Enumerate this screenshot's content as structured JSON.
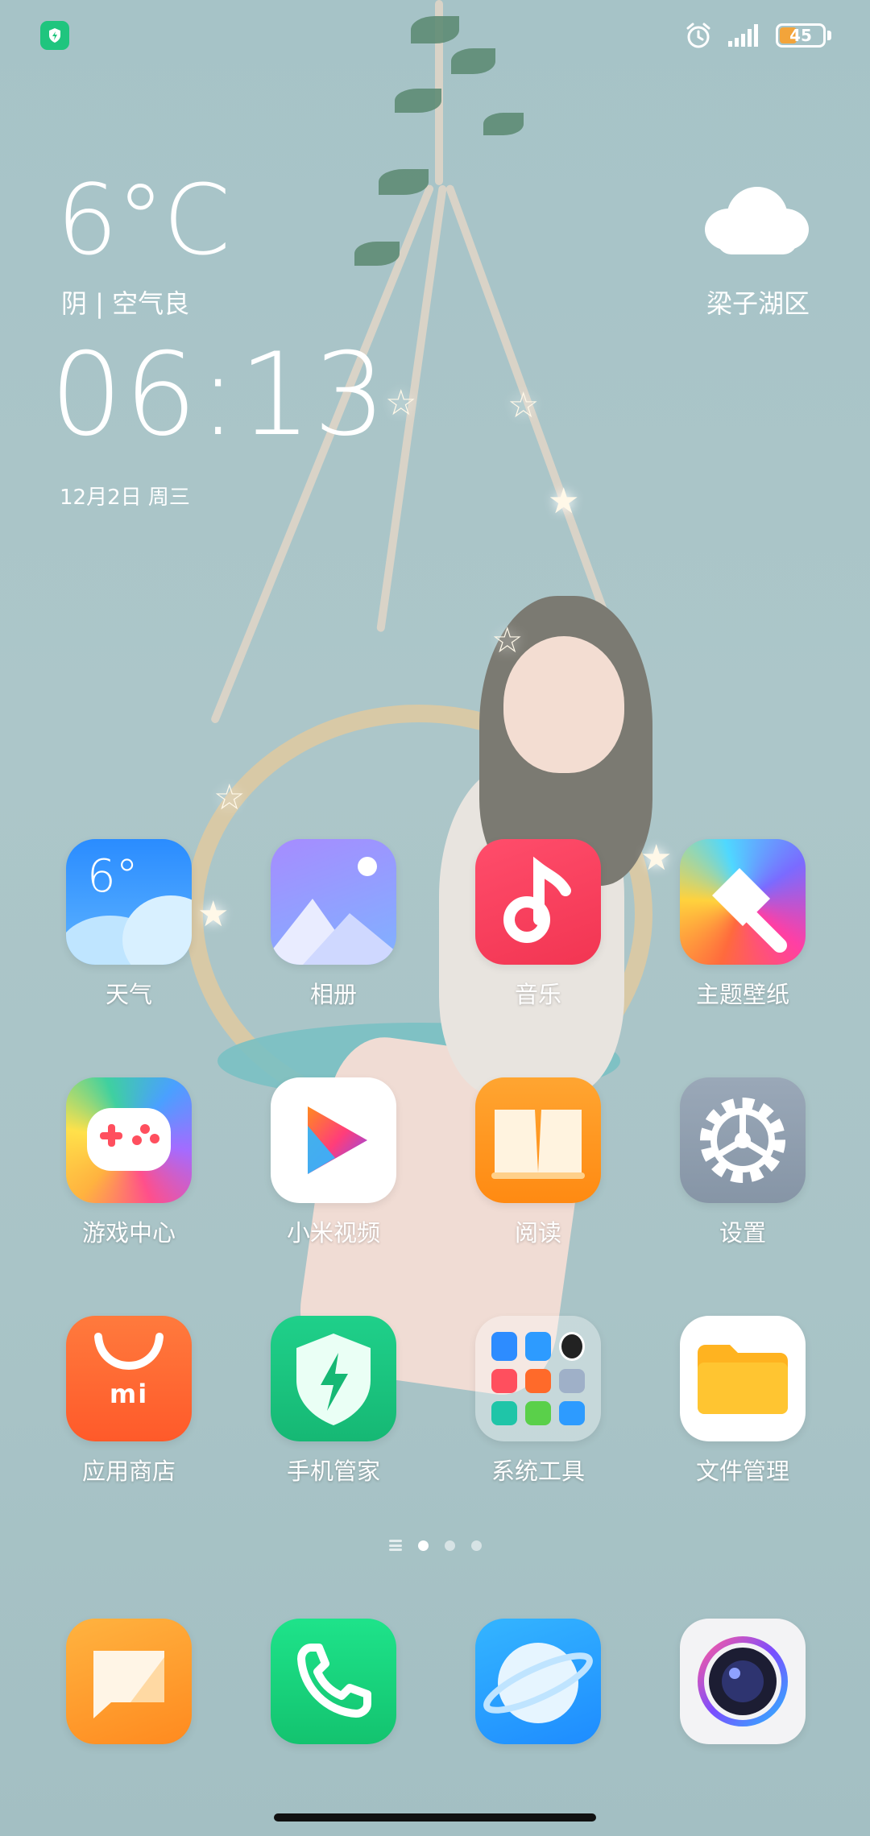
{
  "status_bar": {
    "battery_level": 45,
    "battery_text": "45",
    "icons": [
      "security-shield-icon",
      "alarm-icon",
      "signal-icon",
      "battery-icon"
    ]
  },
  "weather_widget": {
    "temperature": "6°C",
    "condition": "阴 | 空气良",
    "location": "梁子湖区",
    "icon": "cloud-icon"
  },
  "clock_widget": {
    "time": "06:13",
    "date": "12月2日 周三"
  },
  "apps": {
    "weather": {
      "label": "天气",
      "badge": "6°"
    },
    "gallery": {
      "label": "相册"
    },
    "music": {
      "label": "音乐"
    },
    "themes": {
      "label": "主题壁纸"
    },
    "game_center": {
      "label": "游戏中心"
    },
    "mi_video": {
      "label": "小米视频"
    },
    "reader": {
      "label": "阅读"
    },
    "settings": {
      "label": "设置"
    },
    "app_store": {
      "label": "应用商店",
      "logo": "mi"
    },
    "security": {
      "label": "手机管家"
    },
    "system_tools": {
      "label": "系统工具"
    },
    "file_manager": {
      "label": "文件管理"
    }
  },
  "dock": [
    "messages-app",
    "phone-app",
    "browser-app",
    "camera-app"
  ],
  "pager": {
    "current_page": 1,
    "total_pages": 3
  },
  "colors": {
    "wallpaper": "#a9c4c7",
    "battery_fill": "#f3a43a",
    "security_green": "#1fc57e"
  }
}
